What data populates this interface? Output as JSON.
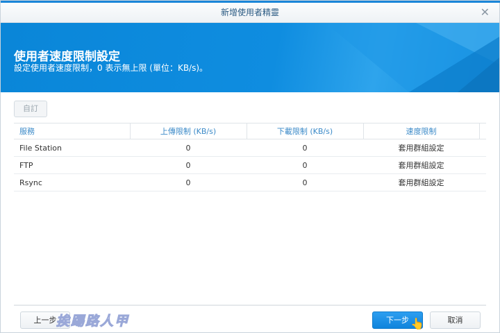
{
  "window": {
    "title": "新增使用者精靈",
    "close": "✕"
  },
  "banner": {
    "title": "使用者速度限制設定",
    "subtitle": "設定使用者速度限制，0 表示無上限 (單位：KB/s)。"
  },
  "toolbar": {
    "custom_label": "自訂"
  },
  "table": {
    "headers": [
      "服務",
      "上傳限制 (KB/s)",
      "下載限制 (KB/s)",
      "速度限制"
    ],
    "rows": [
      [
        "File Station",
        "0",
        "0",
        "套用群組設定"
      ],
      [
        "FTP",
        "0",
        "0",
        "套用群組設定"
      ],
      [
        "Rsync",
        "0",
        "0",
        "套用群組設定"
      ]
    ]
  },
  "footer": {
    "prev": "上一步",
    "next": "下一步",
    "cancel": "取消"
  },
  "watermark": "挨踢路人甲"
}
